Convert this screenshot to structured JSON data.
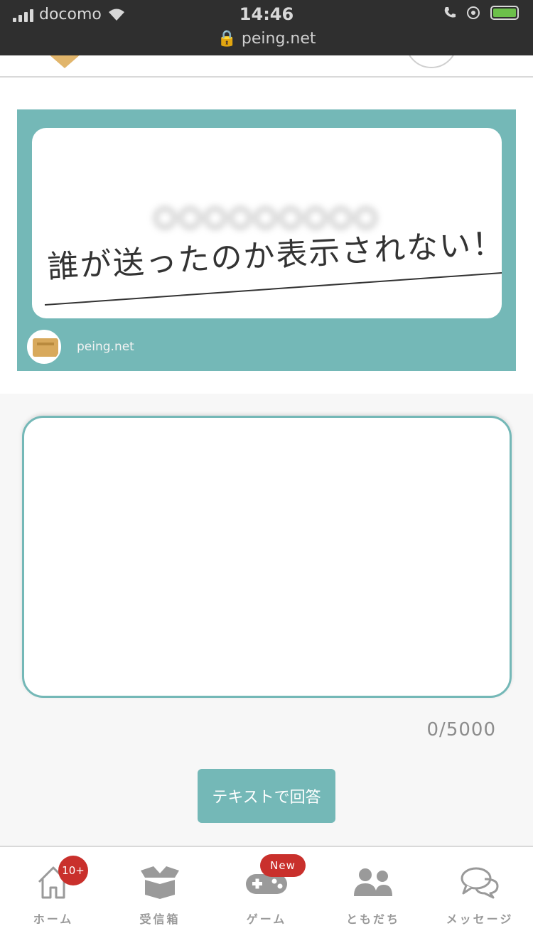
{
  "status_bar": {
    "carrier": "docomo",
    "time": "14:46",
    "url": "peing.net"
  },
  "question_card": {
    "blurred_question": "◯◯◯◯◯◯◯◯◯",
    "anonymity_note": "誰が送ったのか表示されない！",
    "domain": "peing.net"
  },
  "answer": {
    "value": "",
    "placeholder": "",
    "char_count": "0/5000"
  },
  "submit_label": "テキストで回答",
  "tabs": [
    {
      "label": "ホーム",
      "icon": "home-icon",
      "badge": "10+"
    },
    {
      "label": "受信箱",
      "icon": "inbox-box-icon"
    },
    {
      "label": "ゲーム",
      "icon": "gamepad-icon",
      "badge": "New"
    },
    {
      "label": "ともだち",
      "icon": "friends-icon"
    },
    {
      "label": "メッセージ",
      "icon": "chat-bubbles-icon"
    }
  ],
  "colors": {
    "accent": "#74b8b7",
    "badge": "#c9302c",
    "tab_icon": "#9a9a9a"
  }
}
